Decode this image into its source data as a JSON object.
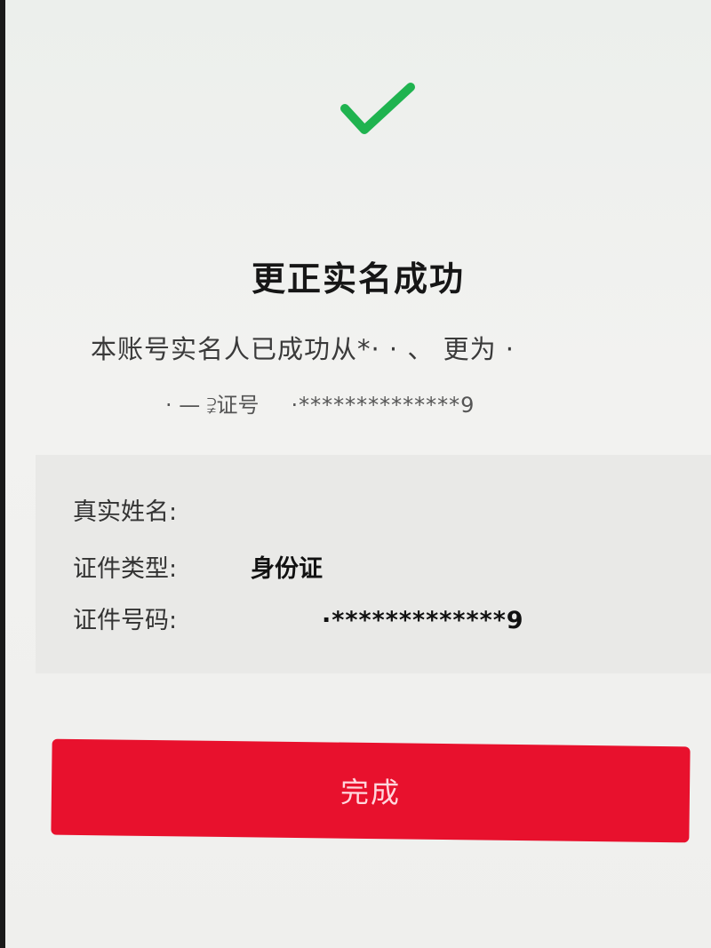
{
  "result": {
    "icon": "check-icon",
    "icon_color": "#1fb34f",
    "title": "更正实名成功",
    "description_line1": "本账号实名人已成功从*·  · 、 更为 ·",
    "description_line2_prefix": "·  —  ⫌证号",
    "description_line2_number": "·**************9"
  },
  "info": {
    "name_label": "真实姓名:",
    "name_value": "",
    "id_type_label": "证件类型:",
    "id_type_value": "身份证",
    "id_number_label": "证件号码:",
    "id_number_value": "·*************9"
  },
  "actions": {
    "done_label": "完成",
    "accent_color": "#e8112d"
  }
}
